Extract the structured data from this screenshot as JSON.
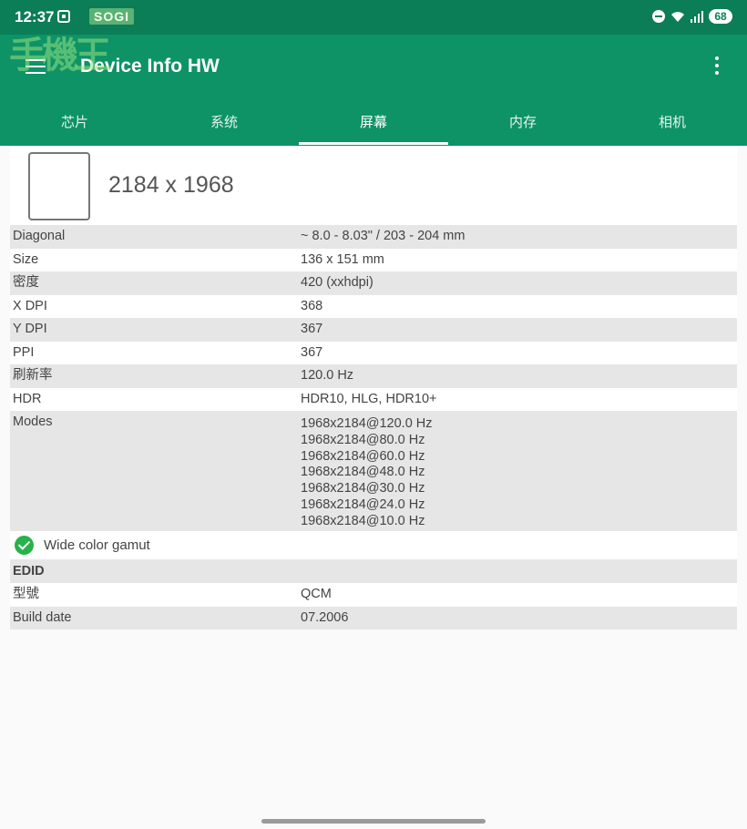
{
  "status_bar": {
    "time": "12:37",
    "battery": "68"
  },
  "watermark": {
    "brand": "SOGI",
    "mark": "手機王"
  },
  "app_bar": {
    "title": "Device Info HW",
    "tabs": [
      "芯片",
      "系统",
      "屏幕",
      "内存",
      "相机"
    ],
    "active_tab": 2
  },
  "screen": {
    "resolution": "2184 x 1968",
    "rows": [
      {
        "label": "Diagonal",
        "value": "~ 8.0 - 8.03\" / 203 - 204 mm"
      },
      {
        "label": "Size",
        "value": "136 x 151 mm"
      },
      {
        "label": "密度",
        "value": "420 (xxhdpi)"
      },
      {
        "label": "X DPI",
        "value": "368"
      },
      {
        "label": "Y DPI",
        "value": "367"
      },
      {
        "label": "PPI",
        "value": "367"
      },
      {
        "label": "刷新率",
        "value": "120.0 Hz"
      },
      {
        "label": "HDR",
        "value": "HDR10, HLG, HDR10+"
      }
    ],
    "modes": {
      "label": "Modes",
      "values": [
        "1968x2184@120.0 Hz",
        "1968x2184@80.0 Hz",
        "1968x2184@60.0 Hz",
        "1968x2184@48.0 Hz",
        "1968x2184@30.0 Hz",
        "1968x2184@24.0 Hz",
        "1968x2184@10.0 Hz"
      ]
    },
    "wide_color_gamut": "Wide color gamut"
  },
  "edid": {
    "header": "EDID",
    "rows": [
      {
        "label": "型號",
        "value": "QCM"
      },
      {
        "label": "Build date",
        "value": "07.2006"
      }
    ]
  },
  "colors": {
    "status_bar": "#0b7d57",
    "app_bar": "#0d9366",
    "check": "#27b24a"
  }
}
